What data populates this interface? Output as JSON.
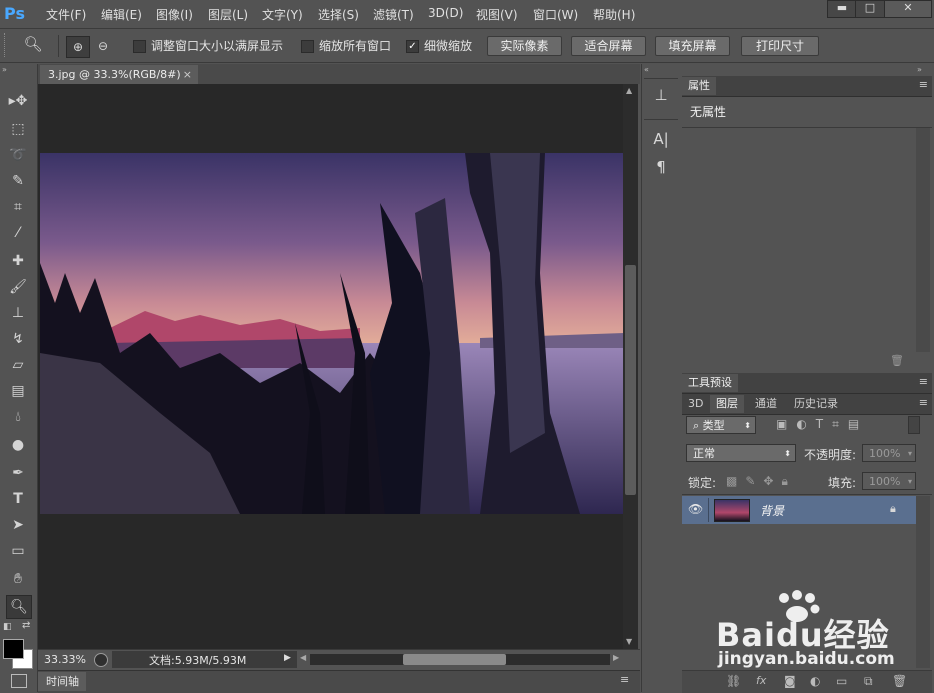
{
  "app": {
    "logo": "Ps"
  },
  "menu": [
    "文件(F)",
    "编辑(E)",
    "图像(I)",
    "图层(L)",
    "文字(Y)",
    "选择(S)",
    "滤镜(T)",
    "3D(D)",
    "视图(V)",
    "窗口(W)",
    "帮助(H)"
  ],
  "window_controls": {
    "minimize": "▬",
    "maximize": "□",
    "close": "✕"
  },
  "options": {
    "resize_windows_label": "调整窗口大小以满屏显示",
    "zoom_all_windows_label": "缩放所有窗口",
    "scrubby_zoom_label": "细微缩放",
    "scrubby_zoom_checked": true,
    "buttons": [
      "实际像素",
      "适合屏幕",
      "填充屏幕",
      "打印尺寸"
    ]
  },
  "document": {
    "tab_title": "3.jpg @ 33.3%(RGB/8#)",
    "tab_close": "×"
  },
  "status": {
    "zoom": "33.33%",
    "doc_size": "文档:5.93M/5.93M"
  },
  "timeline_label": "时间轴",
  "properties_panel": {
    "tab": "属性",
    "content": "无属性"
  },
  "tool_presets_panel": {
    "tab": "工具预设"
  },
  "layers_panel": {
    "tabs": [
      "3D",
      "图层",
      "通道",
      "历史记录"
    ],
    "active_tab": "图层",
    "filter_kind": "类型",
    "blend_mode": "正常",
    "opacity_label": "不透明度:",
    "opacity_value": "100%",
    "lock_label": "锁定:",
    "fill_label": "填充:",
    "fill_value": "100%",
    "layers": [
      {
        "name": "背景",
        "visible": true,
        "locked": true
      }
    ]
  },
  "watermark": {
    "brand": "Baidu经验",
    "url": "jingyan.baidu.com"
  },
  "colors": {
    "accent_blue": "#49a8ff",
    "panel_bg": "#535353",
    "canvas_bg": "#282828"
  }
}
